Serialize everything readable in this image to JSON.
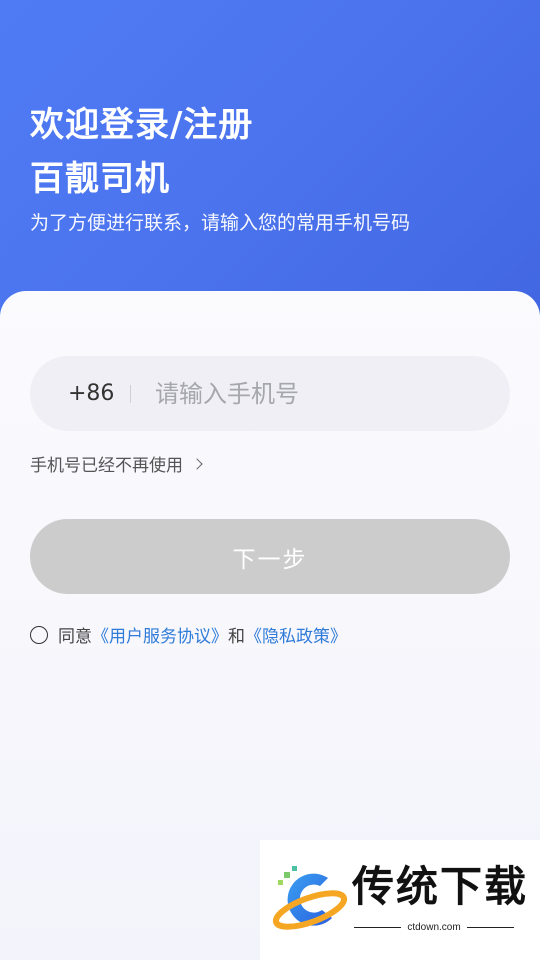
{
  "header": {
    "title_line1": "欢迎登录/注册",
    "title_line2": "百靓司机",
    "subtitle": "为了方便进行联系，请输入您的常用手机号码"
  },
  "phone": {
    "country_code": "+86",
    "placeholder": "请输入手机号",
    "value": ""
  },
  "unused_link": {
    "label": "手机号已经不再使用",
    "icon": "chevron-right-icon"
  },
  "next_button": {
    "label": "下一步",
    "enabled": false
  },
  "agreement": {
    "checked": false,
    "prefix": "同意",
    "terms_link": "《用户服务协议》",
    "conjunction": "和",
    "privacy_link": "《隐私政策》"
  },
  "watermark": {
    "title": "传统下载",
    "site": "ctdown.com"
  },
  "colors": {
    "header_gradient_start": "#4f7cf5",
    "header_gradient_end": "#4266e2",
    "link": "#2f7bd8",
    "button_disabled": "#cccccc"
  }
}
